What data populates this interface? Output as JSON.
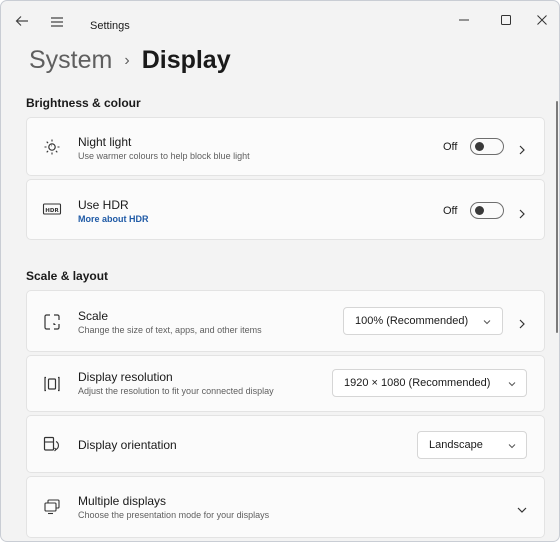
{
  "titlebar": {
    "title": "Settings",
    "back_icon": "back-arrow-icon",
    "menu_icon": "hamburger-menu-icon"
  },
  "window_controls": [
    "minimize-icon",
    "maximize-icon",
    "close-icon"
  ],
  "breadcrumb": {
    "parent": "System",
    "separator": "›",
    "current": "Display"
  },
  "sections": {
    "brightness": "Brightness & colour",
    "scale": "Scale & layout"
  },
  "night_light": {
    "icon": "night-light-icon",
    "title": "Night light",
    "desc": "Use warmer colours to help block blue light",
    "state": "Off",
    "on": false
  },
  "hdr": {
    "icon": "hdr-icon",
    "icon_text": "HDR",
    "title": "Use HDR",
    "link": "More about HDR",
    "state": "Off",
    "on": false
  },
  "scale": {
    "icon": "scale-icon",
    "title": "Scale",
    "desc": "Change the size of text, apps, and other items",
    "value": "100% (Recommended)"
  },
  "resolution": {
    "icon": "display-resolution-icon",
    "title": "Display resolution",
    "desc": "Adjust the resolution to fit your connected display",
    "value": "1920 × 1080 (Recommended)"
  },
  "orientation": {
    "icon": "display-orientation-icon",
    "title": "Display orientation",
    "value": "Landscape"
  },
  "multiple": {
    "icon": "multiple-displays-icon",
    "title": "Multiple displays",
    "desc": "Choose the presentation mode for your displays"
  }
}
